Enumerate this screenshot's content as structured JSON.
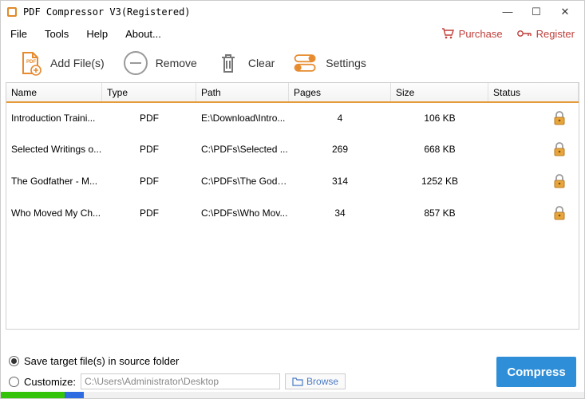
{
  "window": {
    "title": "PDF Compressor V3(Registered)"
  },
  "menu": {
    "file": "File",
    "tools": "Tools",
    "help": "Help",
    "about": "About...",
    "purchase": "Purchase",
    "register": "Register"
  },
  "toolbar": {
    "add": "Add File(s)",
    "remove": "Remove",
    "clear": "Clear",
    "settings": "Settings"
  },
  "table": {
    "headers": {
      "name": "Name",
      "type": "Type",
      "path": "Path",
      "pages": "Pages",
      "size": "Size",
      "status": "Status"
    },
    "rows": [
      {
        "name": "Introduction Traini...",
        "type": "PDF",
        "path": "E:\\Download\\Intro...",
        "pages": "4",
        "size": "106 KB"
      },
      {
        "name": "Selected Writings o...",
        "type": "PDF",
        "path": "C:\\PDFs\\Selected ...",
        "pages": "269",
        "size": "668 KB"
      },
      {
        "name": "The Godfather - M...",
        "type": "PDF",
        "path": "C:\\PDFs\\The Godfa...",
        "pages": "314",
        "size": "1252 KB"
      },
      {
        "name": "Who Moved My Ch...",
        "type": "PDF",
        "path": "C:\\PDFs\\Who Mov...",
        "pages": "34",
        "size": "857 KB"
      }
    ]
  },
  "footer": {
    "save_in_source": "Save target file(s) in source folder",
    "customize": "Customize:",
    "custom_path": "C:\\Users\\Administrator\\Desktop",
    "browse": "Browse",
    "compress": "Compress"
  }
}
